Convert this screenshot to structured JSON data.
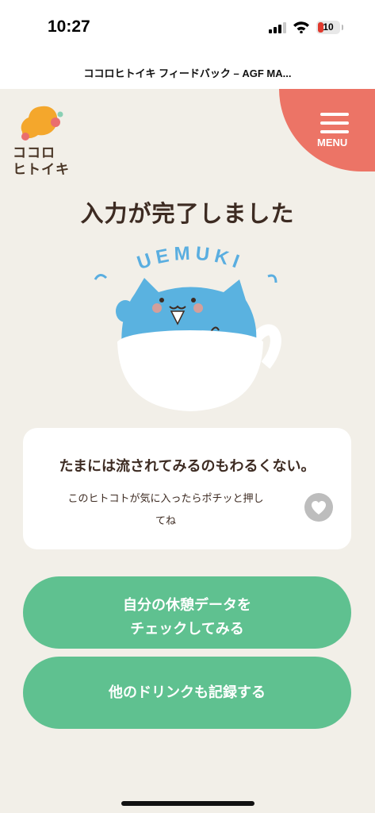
{
  "status_bar": {
    "time": "10:27",
    "battery": "10",
    "battery_color": "#e03a2e"
  },
  "browser": {
    "page_title": "ココロヒトイキ フィードバック – AGF MA..."
  },
  "header": {
    "logo_text": [
      "ココロ",
      "ヒトイキ"
    ],
    "menu_label": "MENU",
    "menu_color": "#ec7466"
  },
  "main": {
    "heading": "入力が完了しました",
    "illustration_text": "UEMUKI",
    "message_card": {
      "title": "たまには流されてみるのもわるくない。",
      "note_line1": "このヒトコトが気に入ったらポチッと押し",
      "note_line2": "てね",
      "like_icon": "heart-icon"
    },
    "buttons": {
      "check_data_line1": "自分の休憩データを",
      "check_data_line2": "チェックしてみる",
      "record_other": "他のドリンクも記録する",
      "color": "#5fc190"
    }
  },
  "colors": {
    "background": "#f2efe8",
    "text": "#3d2b22"
  }
}
